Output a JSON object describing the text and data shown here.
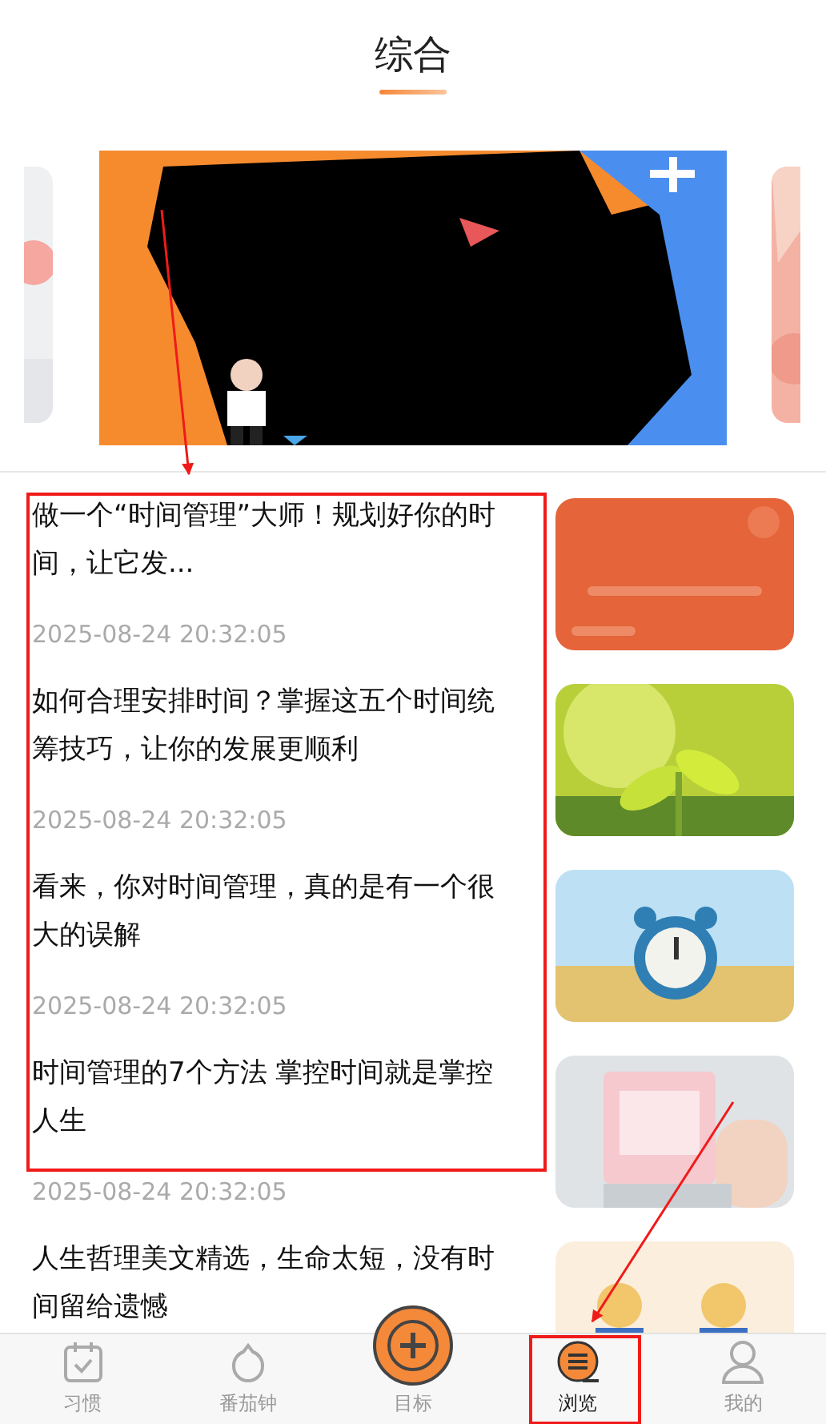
{
  "header_tabs": [
    {
      "label": "综合",
      "selected": true
    }
  ],
  "articles": [
    {
      "title": "做一个“时间管理”大师！规划好你的时间，让它发...",
      "date": "2025-08-24 20:32:05"
    },
    {
      "title": "如何合理安排时间？掌握这五个时间统筹技巧，让你的发展更顺利",
      "date": "2025-08-24 20:32:05"
    },
    {
      "title": "看来，你对时间管理，真的是有一个很大的误解",
      "date": "2025-08-24 20:32:05"
    },
    {
      "title": "时间管理的7个方法 掌控时间就是掌控人生",
      "date": "2025-08-24 20:32:05"
    },
    {
      "title": "人生哲理美文精选，生命太短，没有时间留给遗憾"
    }
  ],
  "bottom_nav": [
    {
      "label": "习惯",
      "kind": "tab",
      "selected": false
    },
    {
      "label": "番茄钟",
      "kind": "tab",
      "selected": false
    },
    {
      "label": "目标",
      "kind": "main",
      "selected": false
    },
    {
      "label": "浏览",
      "kind": "tab",
      "selected": true
    },
    {
      "label": "我的",
      "kind": "tab",
      "selected": false
    }
  ]
}
